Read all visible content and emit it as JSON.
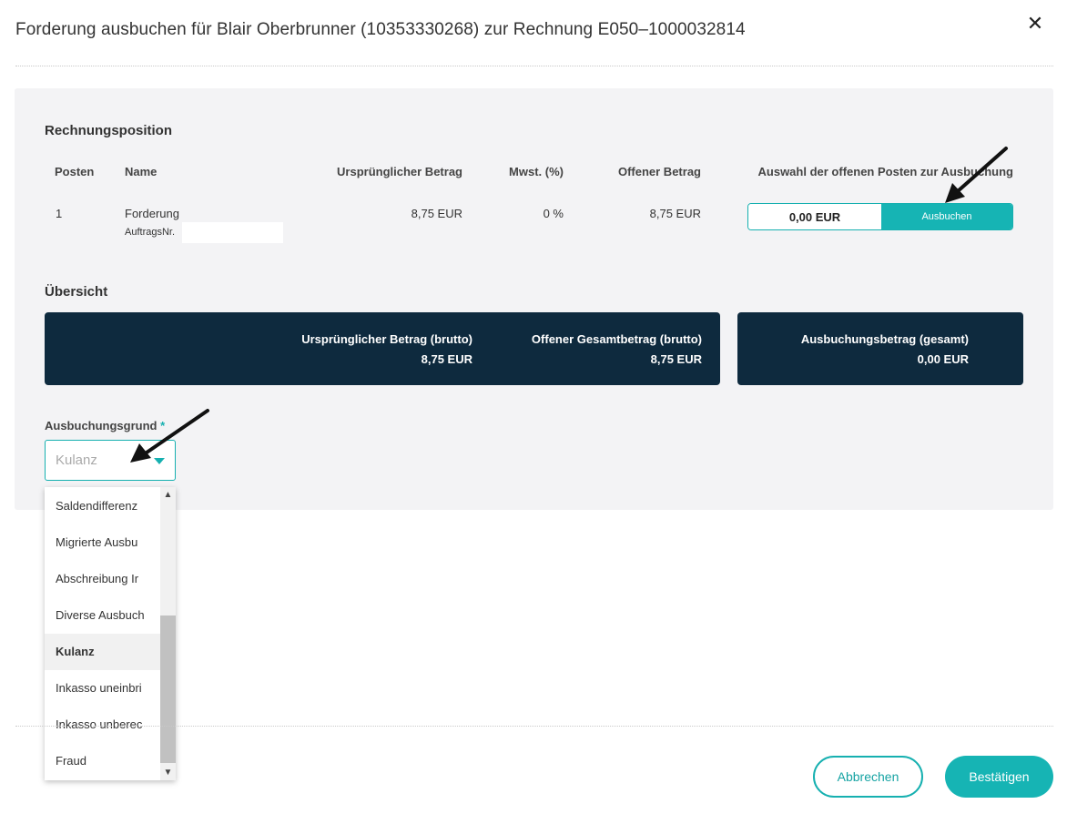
{
  "modal": {
    "title": "Forderung ausbuchen für Blair Oberbrunner (10353330268) zur Rechnung E050–1000032814",
    "close_icon": "close-icon"
  },
  "rechnungsposition": {
    "section_title": "Rechnungsposition",
    "headers": {
      "posten": "Posten",
      "name": "Name",
      "urspruenglicher_betrag": "Ursprünglicher Betrag",
      "mwst": "Mwst. (%)",
      "offener_betrag": "Offener Betrag",
      "auswahl": "Auswahl der offenen Posten zur Ausbuchung"
    },
    "rows": [
      {
        "posten": "1",
        "name": "Forderung",
        "sub_label": "AuftragsNr.",
        "urspruenglicher_betrag": "8,75 EUR",
        "mwst": "0 %",
        "offener_betrag": "8,75 EUR",
        "amount_value": "0,00 EUR",
        "action_label": "Ausbuchen"
      }
    ]
  },
  "uebersicht": {
    "section_title": "Übersicht",
    "urspruenglicher_label": "Ursprünglicher Betrag (brutto)",
    "urspruenglicher_value": "8,75 EUR",
    "offener_label": "Offener Gesamtbetrag (brutto)",
    "offener_value": "8,75 EUR",
    "ausbuchung_label": "Ausbuchungsbetrag (gesamt)",
    "ausbuchung_value": "0,00 EUR"
  },
  "ausbuchungsgrund": {
    "label": "Ausbuchungsgrund",
    "required_marker": "*",
    "selected": "Kulanz",
    "options": [
      "Saldendifferenz",
      "Migrierte Ausbu",
      "Abschreibung Ir",
      "Diverse Ausbuch",
      "Kulanz",
      "Inkasso uneinbri",
      "Inkasso unberec",
      "Fraud"
    ]
  },
  "footer": {
    "cancel_label": "Abbrechen",
    "confirm_label": "Bestätigen"
  },
  "colors": {
    "accent": "#16b4b4",
    "dark_card": "#0e2a3e",
    "panel_bg": "#f3f3f5"
  }
}
